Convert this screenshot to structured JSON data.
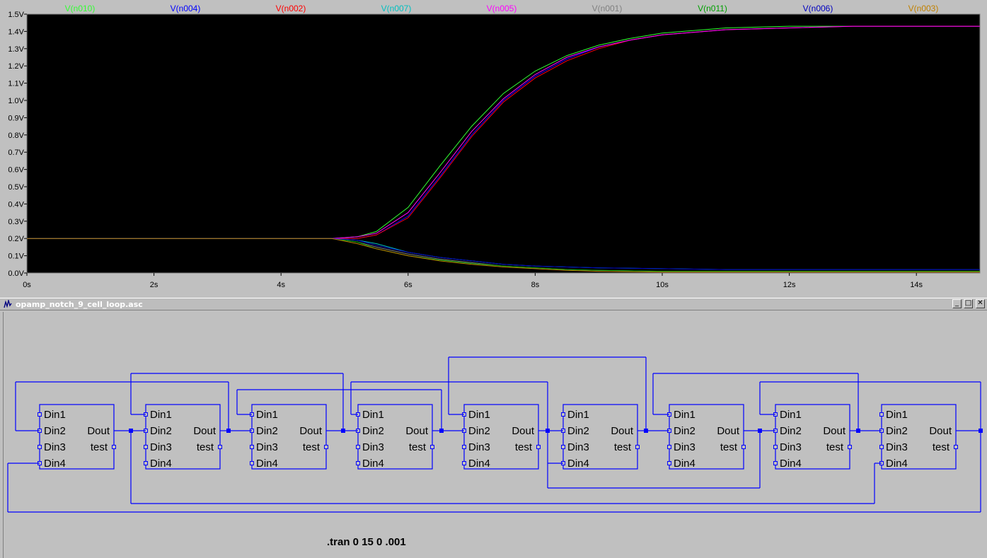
{
  "plot": {
    "background": "#000000",
    "axis_color": "#7f7f7f",
    "legend": [
      {
        "label": "V(n010)",
        "color": "#33ff33"
      },
      {
        "label": "V(n004)",
        "color": "#0000ff"
      },
      {
        "label": "V(n002)",
        "color": "#ff0000"
      },
      {
        "label": "V(n007)",
        "color": "#00c0c0"
      },
      {
        "label": "V(n005)",
        "color": "#ff00ff"
      },
      {
        "label": "V(n001)",
        "color": "#808080"
      },
      {
        "label": "V(n011)",
        "color": "#00a000"
      },
      {
        "label": "V(n006)",
        "color": "#0000c0"
      },
      {
        "label": "V(n003)",
        "color": "#c08000"
      }
    ],
    "y_ticks": [
      "1.5V",
      "1.4V",
      "1.3V",
      "1.2V",
      "1.1V",
      "1.0V",
      "0.9V",
      "0.8V",
      "0.7V",
      "0.6V",
      "0.5V",
      "0.4V",
      "0.3V",
      "0.2V",
      "0.1V",
      "0.0V"
    ],
    "x_ticks": [
      "0s",
      "2s",
      "4s",
      "6s",
      "8s",
      "10s",
      "12s",
      "14s"
    ]
  },
  "chart_data": {
    "type": "line",
    "xlabel": "",
    "ylabel": "",
    "xlim": [
      0,
      15
    ],
    "ylim": [
      0,
      1.5
    ],
    "grid": false,
    "legend_position": "top",
    "series": [
      {
        "name": "V(n010)",
        "color": "#33ff33",
        "x": [
          0,
          4.8,
          5.2,
          5.5,
          6,
          6.5,
          7,
          7.5,
          8,
          8.5,
          9,
          9.5,
          10,
          11,
          12,
          13,
          14,
          15
        ],
        "y": [
          0.2,
          0.2,
          0.21,
          0.24,
          0.38,
          0.62,
          0.85,
          1.04,
          1.17,
          1.26,
          1.32,
          1.36,
          1.39,
          1.42,
          1.43,
          1.43,
          1.43,
          1.43
        ]
      },
      {
        "name": "V(n004)",
        "color": "#0000ff",
        "x": [
          0,
          4.8,
          5.2,
          5.5,
          6,
          6.5,
          7,
          7.5,
          8,
          8.5,
          9,
          9.5,
          10,
          11,
          12,
          13,
          14,
          15
        ],
        "y": [
          0.2,
          0.2,
          0.2,
          0.22,
          0.33,
          0.56,
          0.8,
          1.0,
          1.14,
          1.24,
          1.31,
          1.35,
          1.38,
          1.41,
          1.42,
          1.43,
          1.43,
          1.43
        ]
      },
      {
        "name": "V(n002)",
        "color": "#ff0000",
        "x": [
          0,
          4.8,
          5.2,
          5.5,
          6,
          6.5,
          7,
          7.5,
          8,
          8.5,
          9,
          9.5,
          10,
          11,
          12,
          13,
          14,
          15
        ],
        "y": [
          0.2,
          0.2,
          0.2,
          0.22,
          0.32,
          0.55,
          0.79,
          0.99,
          1.13,
          1.23,
          1.3,
          1.35,
          1.38,
          1.41,
          1.42,
          1.43,
          1.43,
          1.43
        ]
      },
      {
        "name": "V(n007)",
        "color": "#00c0c0",
        "x": [
          0,
          4.8,
          5.2,
          5.5,
          6,
          6.5,
          7,
          7.5,
          8,
          8.5,
          9,
          10,
          11,
          12,
          13,
          14,
          15
        ],
        "y": [
          0.2,
          0.2,
          0.19,
          0.17,
          0.12,
          0.09,
          0.07,
          0.05,
          0.04,
          0.035,
          0.03,
          0.025,
          0.02,
          0.02,
          0.02,
          0.02,
          0.02
        ]
      },
      {
        "name": "V(n005)",
        "color": "#ff00ff",
        "x": [
          0,
          4.8,
          5.2,
          5.5,
          6,
          6.5,
          7,
          7.5,
          8,
          8.5,
          9,
          9.5,
          10,
          11,
          12,
          13,
          14,
          15
        ],
        "y": [
          0.2,
          0.2,
          0.21,
          0.23,
          0.35,
          0.58,
          0.82,
          1.01,
          1.15,
          1.25,
          1.31,
          1.35,
          1.38,
          1.41,
          1.42,
          1.43,
          1.43,
          1.43
        ]
      },
      {
        "name": "V(n001)",
        "color": "#808080",
        "x": [
          0,
          4.8,
          5.2,
          5.5,
          6,
          6.5,
          7,
          7.5,
          8,
          8.5,
          9,
          10,
          11,
          12,
          13,
          14,
          15
        ],
        "y": [
          0.2,
          0.2,
          0.18,
          0.15,
          0.11,
          0.08,
          0.06,
          0.04,
          0.03,
          0.02,
          0.015,
          0.01,
          0.01,
          0.01,
          0.01,
          0.01,
          0.01
        ]
      },
      {
        "name": "V(n011)",
        "color": "#00a000",
        "x": [
          0,
          4.8,
          5.2,
          5.5,
          6,
          6.5,
          7,
          7.5,
          8,
          8.5,
          9,
          10,
          11,
          12,
          13,
          14,
          15
        ],
        "y": [
          0.2,
          0.2,
          0.18,
          0.14,
          0.1,
          0.075,
          0.055,
          0.04,
          0.03,
          0.02,
          0.015,
          0.01,
          0.01,
          0.01,
          0.01,
          0.01,
          0.01
        ]
      },
      {
        "name": "V(n006)",
        "color": "#0000c0",
        "x": [
          0,
          4.8,
          5.2,
          5.5,
          6,
          6.5,
          7,
          7.5,
          8,
          8.5,
          9,
          10,
          11,
          12,
          13,
          14,
          15
        ],
        "y": [
          0.2,
          0.2,
          0.19,
          0.16,
          0.12,
          0.09,
          0.07,
          0.05,
          0.04,
          0.035,
          0.03,
          0.025,
          0.02,
          0.02,
          0.02,
          0.02,
          0.02
        ]
      },
      {
        "name": "V(n003)",
        "color": "#c08000",
        "x": [
          0,
          4.8,
          5.2,
          5.5,
          6,
          6.5,
          7,
          7.5,
          8,
          8.5,
          9,
          10,
          11,
          12,
          13,
          14,
          15
        ],
        "y": [
          0.2,
          0.2,
          0.17,
          0.14,
          0.1,
          0.07,
          0.05,
          0.035,
          0.025,
          0.015,
          0.01,
          0.005,
          0.005,
          0.005,
          0.005,
          0.005,
          0.005
        ]
      }
    ]
  },
  "schematic": {
    "window_title": "opamp_notch_9_cell_loop.asc",
    "icons": {
      "app": "ltspice-icon",
      "minimize": "minimize-icon",
      "maximize": "maximize-icon",
      "close": "close-icon"
    },
    "buttons": {
      "minimize": "_",
      "maximize": "□",
      "close": "✕"
    },
    "wire_color": "#0000ff",
    "block_pins_left": [
      "Din1",
      "Din2",
      "Din3",
      "Din4"
    ],
    "block_pins_right": [
      "Dout",
      "test"
    ],
    "block_count": 9,
    "directive": ".tran 0 15 0 .001"
  }
}
